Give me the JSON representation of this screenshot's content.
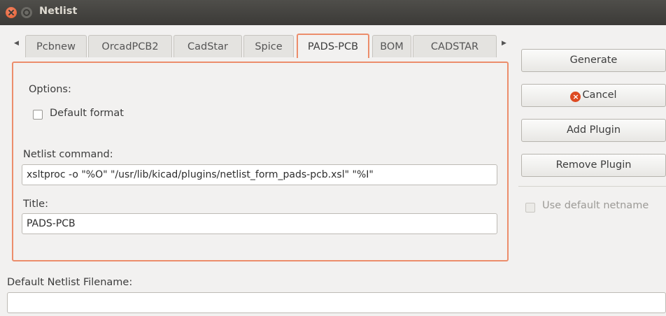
{
  "window": {
    "title": "Netlist"
  },
  "tabs": [
    "Pcbnew",
    "OrcadPCB2",
    "CadStar",
    "Spice",
    "PADS-PCB",
    "BOM",
    "CADSTAR"
  ],
  "active_tab": "PADS-PCB",
  "options_label": "Options:",
  "default_format": {
    "label": "Default format",
    "checked": false
  },
  "netlist_command": {
    "label": "Netlist command:",
    "value": "xsltproc -o \"%O\" \"/usr/lib/kicad/plugins/netlist_form_pads-pcb.xsl\" \"%I\""
  },
  "title_field": {
    "label": "Title:",
    "value": "PADS-PCB"
  },
  "buttons": {
    "generate": "Generate",
    "cancel": "Cancel",
    "add_plugin": "Add Plugin",
    "remove_plugin": "Remove Plugin"
  },
  "use_default_netname": {
    "label": "Use default netname",
    "checked": false,
    "enabled": false
  },
  "default_filename": {
    "label": "Default Netlist Filename:",
    "value": ""
  },
  "colors": {
    "accent": "#ec8d6b",
    "titlebar": "#3b3a37",
    "close": "#e05a2b",
    "cancel_icon": "#dd4a22"
  }
}
